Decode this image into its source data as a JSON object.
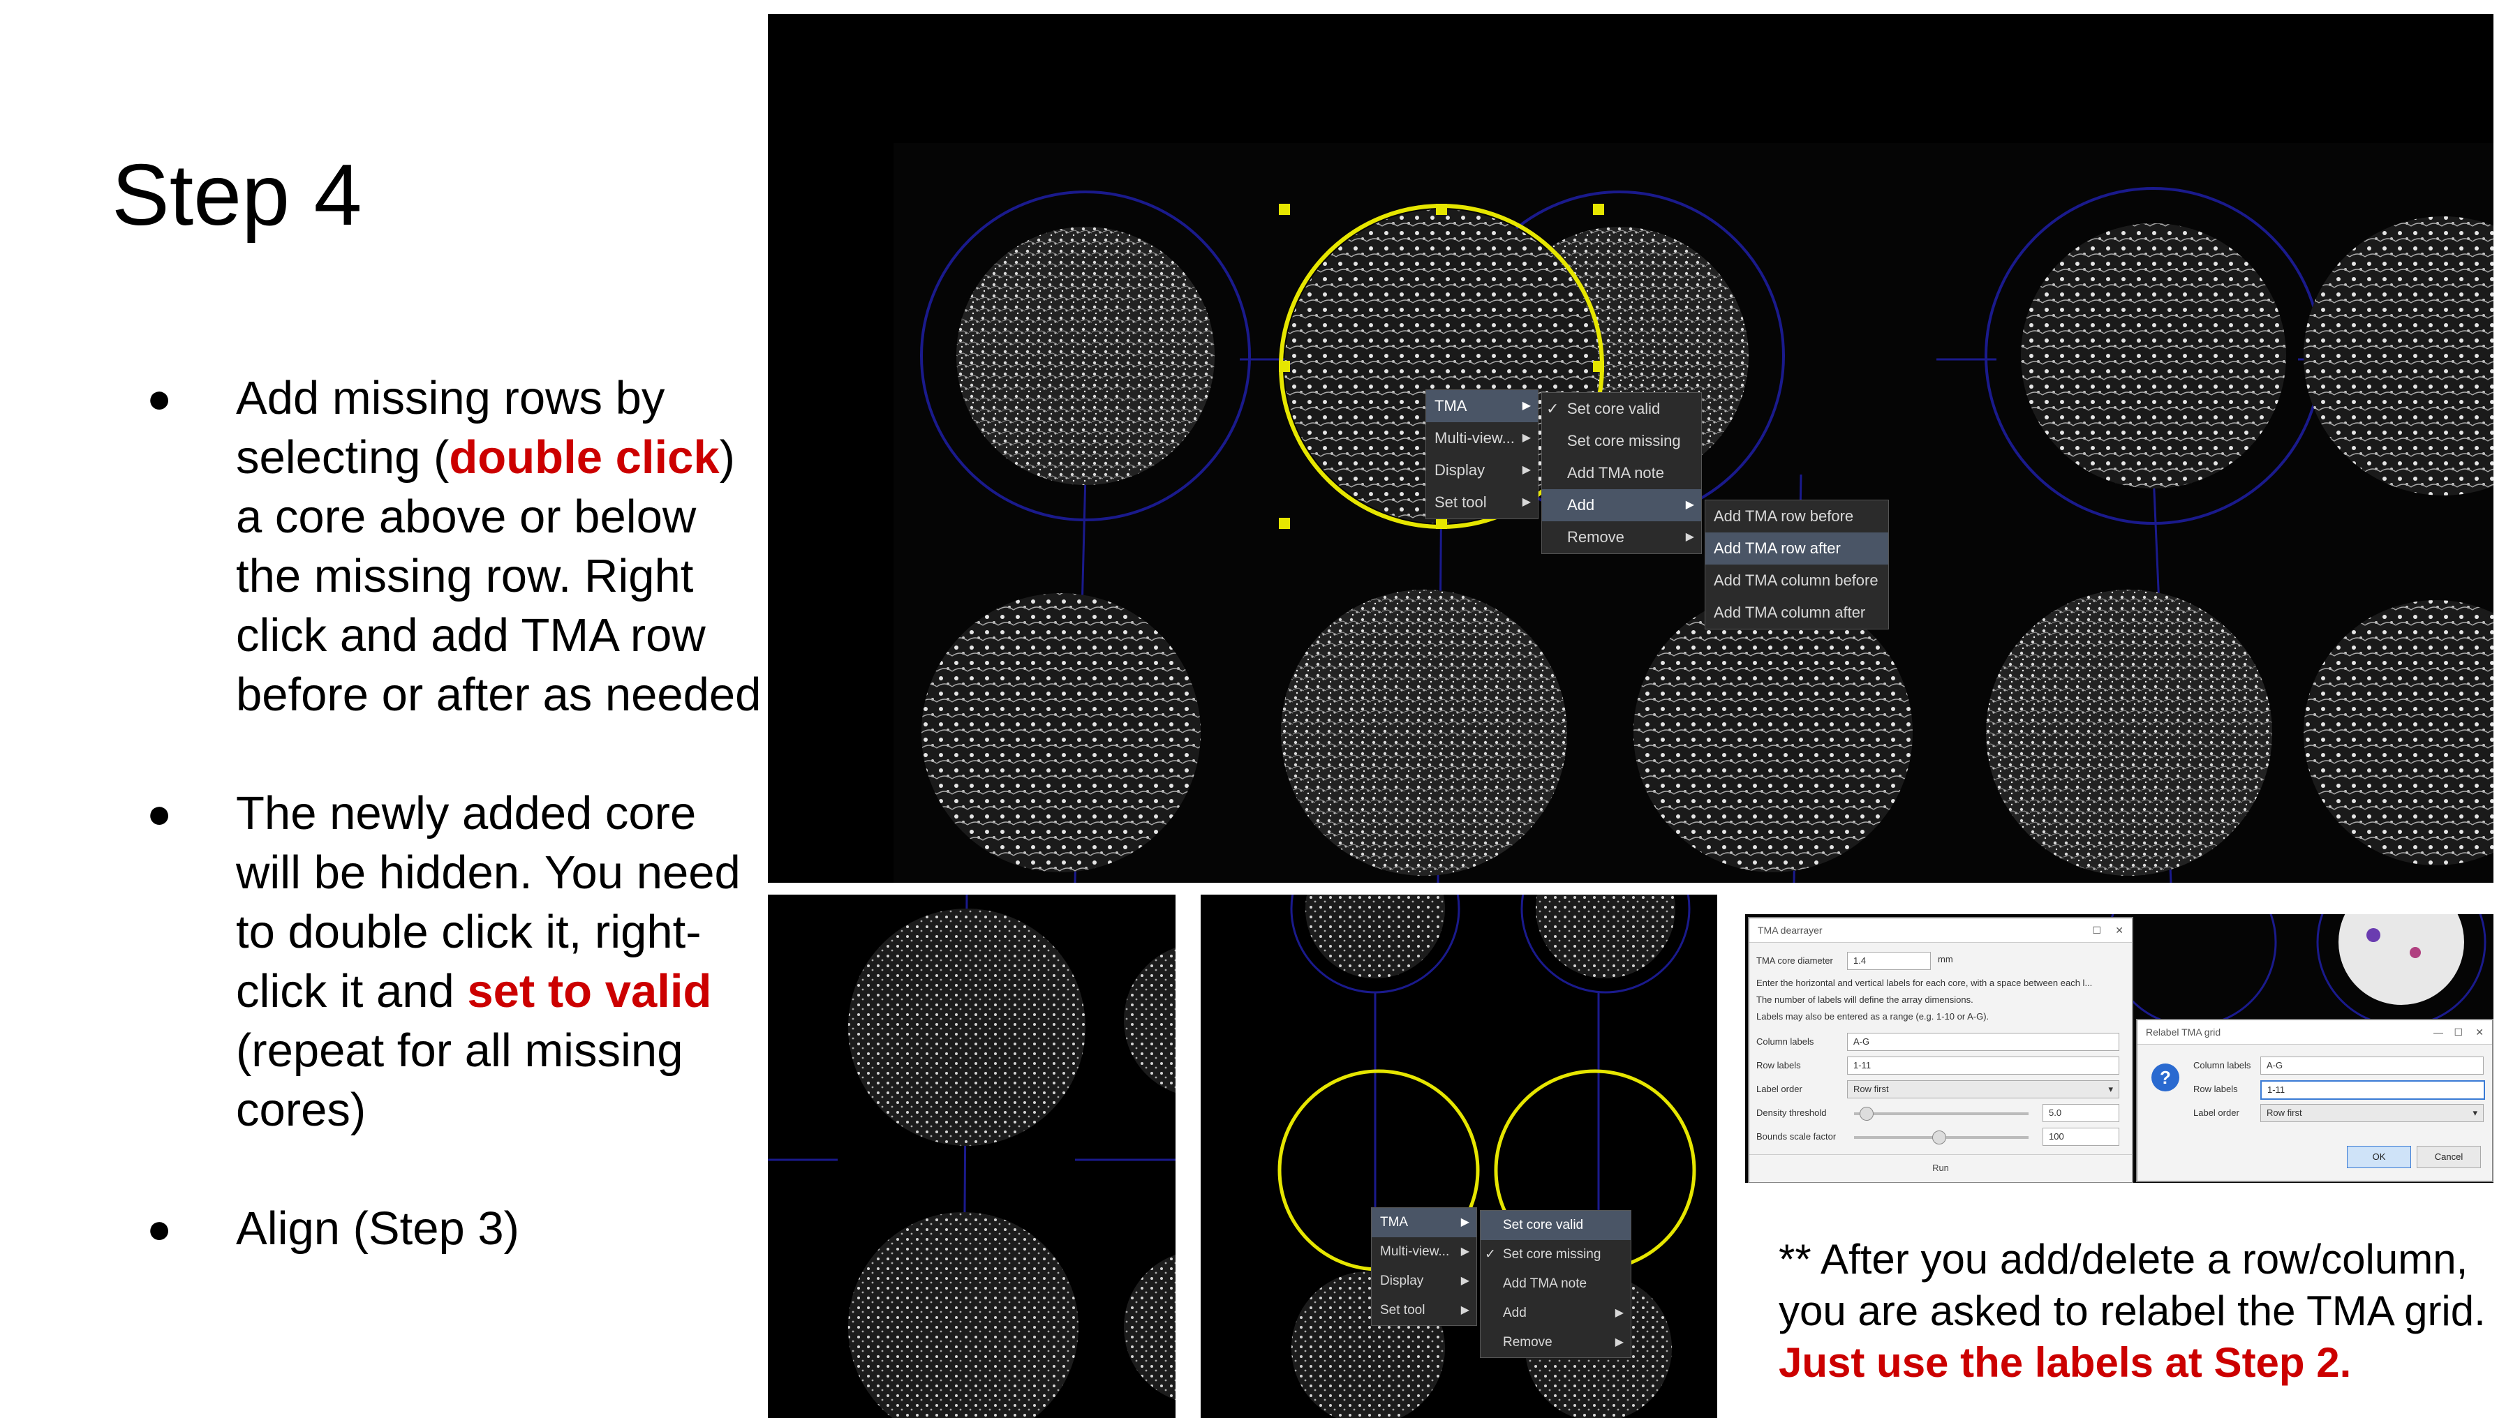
{
  "slide": {
    "title": "Step 4",
    "bullets": [
      {
        "p1": "Add missing rows by selecting (",
        "red": "double click",
        "p2": ") a core above or below the missing row. Right click and add TMA row before or after as needed"
      },
      {
        "p1": "The newly added core will be hidden. You need to double click it, right-click it and ",
        "red": "set to valid",
        "p2": " (repeat for all missing cores)"
      },
      {
        "p1": "Align (Step 3)",
        "red": "",
        "p2": ""
      }
    ],
    "note_p1": "** After you add/delete a row/column, you are asked to relabel the TMA grid. ",
    "note_red": "Just use the labels at Step 2."
  },
  "context_menu_main": {
    "items": [
      "TMA",
      "Multi-view...",
      "Display",
      "Set tool"
    ],
    "tma_submenu": [
      "Set core valid",
      "Set core missing",
      "Add TMA note",
      "Add",
      "Remove"
    ],
    "add_submenu": [
      "Add TMA row before",
      "Add TMA row after",
      "Add TMA column before",
      "Add TMA column after"
    ]
  },
  "context_menu_small": {
    "items": [
      "TMA",
      "Multi-view...",
      "Display",
      "Set tool"
    ],
    "tma_submenu": [
      "Set core valid",
      "Set core missing",
      "Add TMA note",
      "Add",
      "Remove"
    ]
  },
  "dearrayer": {
    "title": "TMA dearrayer",
    "core_diameter_label": "TMA core diameter",
    "core_diameter_value": "1.4",
    "unit": "mm",
    "info1": "Enter the horizontal and vertical labels for each core, with a space between each l...",
    "info2": "The number of labels will define the array dimensions.",
    "info3": "Labels may also be entered as a range (e.g. 1-10 or A-G).",
    "column_labels_label": "Column labels",
    "column_labels_value": "A-G",
    "row_labels_label": "Row labels",
    "row_labels_value": "1-11",
    "label_order_label": "Label order",
    "label_order_value": "Row first",
    "density_label": "Density threshold",
    "density_value": "5.0",
    "bounds_label": "Bounds scale factor",
    "bounds_value": "100",
    "run_label": "Run"
  },
  "relabel": {
    "title": "Relabel TMA grid",
    "column_labels_label": "Column labels",
    "column_labels_value": "A-G",
    "row_labels_label": "Row labels",
    "row_labels_value": "1-11",
    "label_order_label": "Label order",
    "label_order_value": "Row first",
    "ok_label": "OK",
    "cancel_label": "Cancel"
  },
  "colors": {
    "accent_red": "#cc0000",
    "grid_blue": "#1a1a8c",
    "selection_yellow": "#e6e600"
  }
}
